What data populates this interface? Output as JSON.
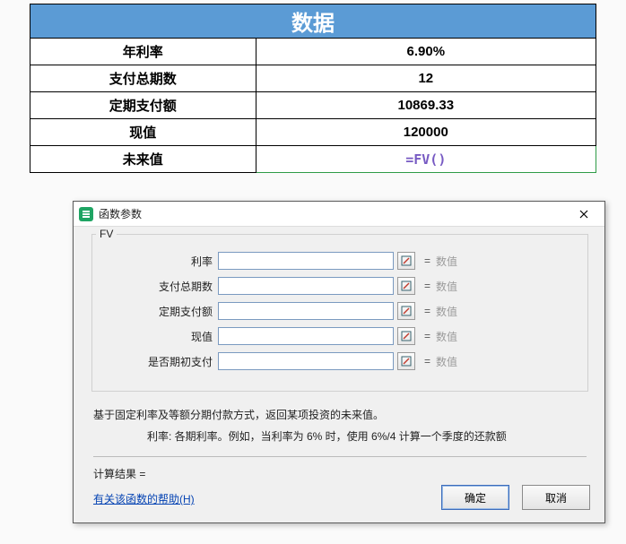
{
  "sheet": {
    "header": "数据",
    "rows": [
      {
        "label": "年利率",
        "value": "6.90%"
      },
      {
        "label": "支付总期数",
        "value": "12"
      },
      {
        "label": "定期支付额",
        "value": "10869.33"
      },
      {
        "label": "现值",
        "value": "120000"
      },
      {
        "label": "未来值",
        "value": "=FV()"
      }
    ]
  },
  "dialog": {
    "title": "函数参数",
    "group_label": "FV",
    "params": [
      {
        "label": "利率",
        "hint": "数值"
      },
      {
        "label": "支付总期数",
        "hint": "数值"
      },
      {
        "label": "定期支付额",
        "hint": "数值"
      },
      {
        "label": "现值",
        "hint": "数值"
      },
      {
        "label": "是否期初支付",
        "hint": "数值"
      }
    ],
    "eq": "=",
    "desc1": "基于固定利率及等额分期付款方式，返回某项投资的未来值。",
    "desc2": "利率:  各期利率。例如，当利率为 6% 时，使用 6%/4 计算一个季度的还款额",
    "result_label": "计算结果 =",
    "help": "有关该函数的帮助(H)",
    "ok": "确定",
    "cancel": "取消"
  }
}
